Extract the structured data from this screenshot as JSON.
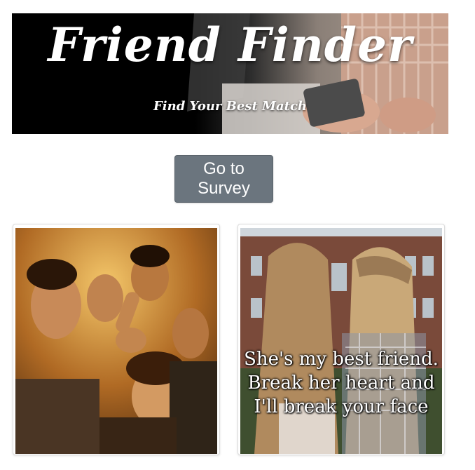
{
  "banner": {
    "title": "Friend Finder",
    "subtitle": "Find Your Best Match"
  },
  "actions": {
    "survey_button": "Go to Survey"
  },
  "cards": [
    {
      "image": "group-selfie-photo",
      "quote_lines": []
    },
    {
      "image": "two-friends-photo",
      "quote_lines": [
        "She's my best friend.",
        "Break her heart and",
        "I'll break your face"
      ]
    }
  ],
  "colors": {
    "button_bg": "#6b757e",
    "banner_bg": "#000000",
    "page_bg": "#ffffff"
  }
}
